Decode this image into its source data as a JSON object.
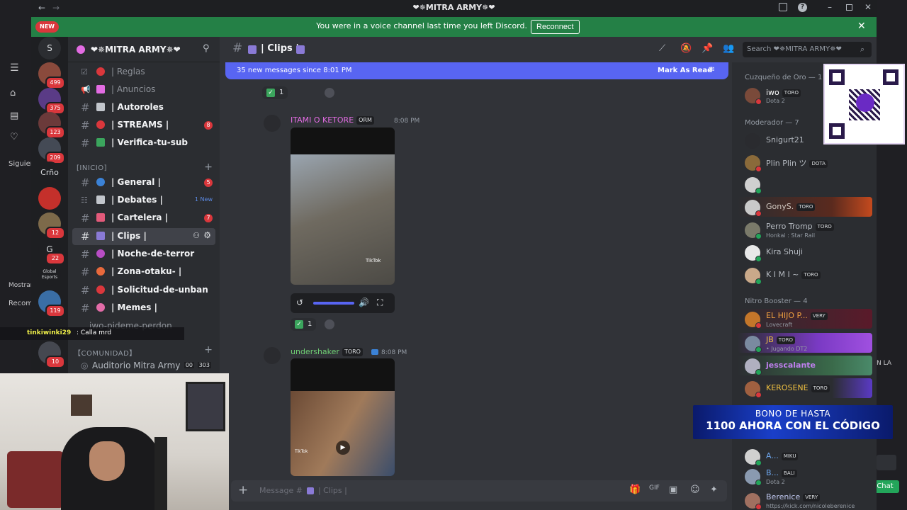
{
  "window": {
    "title": "❤✵MITRA ARMY✵❤"
  },
  "notice": {
    "text": "You were in a voice channel last time you left Discord.",
    "button": "Reconnect"
  },
  "guilds": [
    {
      "label": "NEW",
      "badge": ""
    },
    {
      "label": "S",
      "badge": ""
    },
    {
      "label": "",
      "badge": "499"
    },
    {
      "label": "",
      "badge": "375"
    },
    {
      "label": "",
      "badge": "123"
    },
    {
      "label": "",
      "badge": "209"
    },
    {
      "label": "Crño",
      "badge": ""
    },
    {
      "label": "",
      "badge": ""
    },
    {
      "label": "",
      "badge": "12"
    },
    {
      "label": "G",
      "badge": "22"
    },
    {
      "label": "Global Esports",
      "badge": ""
    },
    {
      "label": "",
      "badge": "119"
    },
    {
      "label": "",
      "badge": "10"
    }
  ],
  "server": {
    "name": "❤✵MITRA ARMY✵❤"
  },
  "channels": {
    "top": [
      {
        "name": "| Reglas",
        "badge": "",
        "muted": true
      },
      {
        "name": "| Anuncios",
        "badge": "",
        "muted": true
      },
      {
        "name": "| Autoroles",
        "badge": "",
        "muted": false
      },
      {
        "name": "| STREAMS |",
        "badge": "8",
        "muted": false
      },
      {
        "name": "| Verifica-tu-sub",
        "badge": "",
        "muted": false
      }
    ],
    "cat_inicio": "[INICIO]",
    "inicio": [
      {
        "name": "| General |",
        "badge": "5",
        "new": ""
      },
      {
        "name": "| Debates |",
        "badge": "",
        "new": "1 New"
      },
      {
        "name": "| Cartelera |",
        "badge": "7",
        "new": ""
      },
      {
        "name": "| Clips |",
        "badge": "",
        "new": ""
      },
      {
        "name": "| Noche-de-terror",
        "badge": "",
        "new": ""
      },
      {
        "name": "| Zona-otaku- |",
        "badge": "",
        "new": ""
      },
      {
        "name": "| Solicitud-de-unban",
        "badge": "",
        "new": ""
      },
      {
        "name": "| Memes |",
        "badge": "",
        "new": ""
      },
      {
        "name": "iwo-pideme-perdon",
        "badge": "",
        "new": ""
      }
    ],
    "cat_comunidad": "【COMUNIDAD】",
    "voice": {
      "name": "Auditorio Mitra Army",
      "count_a": "00",
      "count_b": "303"
    }
  },
  "chat": {
    "channel_title": "| Clips |",
    "search_placeholder": "Search ❤✵MITRA ARMY✵❤",
    "new_messages": "35 new messages since 8:01 PM",
    "mark_as_read": "Mark As Read",
    "reaction_count": "1",
    "messages": [
      {
        "author": "ITAMI O KETORE",
        "tag": "ORM",
        "time": "8:08 PM",
        "color": "#e36ce3"
      },
      {
        "author": "undershaker",
        "tag": "TORO",
        "time": "8:08 PM",
        "color": "#6fcf73"
      }
    ],
    "video_watermark": "TikTok",
    "input_placeholder": "Message #",
    "input_channel": "| Clips |"
  },
  "members": {
    "groups": [
      {
        "title": "Cuzqueño de Oro — 1",
        "items": [
          {
            "name": "iwo",
            "tag": "TORO",
            "sub": "Dota 2"
          }
        ]
      },
      {
        "title": "Moderador — 7",
        "items": [
          {
            "name": "Snigurt21",
            "tag": "",
            "sub": ""
          },
          {
            "name": "Plin Plin ツ",
            "tag": "DOTA",
            "sub": ""
          },
          {
            "name": "",
            "tag": "",
            "sub": ""
          },
          {
            "name": "GonyS.",
            "tag": "TORO",
            "sub": ""
          },
          {
            "name": "Perro Tromp",
            "tag": "TORO",
            "sub": "Honkai : Star Rail"
          },
          {
            "name": "Kira Shuji",
            "tag": "",
            "sub": ""
          },
          {
            "name": "K I M I ~",
            "tag": "TORO",
            "sub": ""
          }
        ]
      },
      {
        "title": "Nitro Booster — 4",
        "items": [
          {
            "name": "EL HIJO P...",
            "tag": "VERY",
            "sub": "Lovecraft"
          },
          {
            "name": "JB",
            "tag": "TORO",
            "sub": "• Jugando DT2"
          },
          {
            "name": "jesscalante",
            "tag": "",
            "sub": ""
          },
          {
            "name": "KEROSENE",
            "tag": "TORO",
            "sub": ""
          }
        ]
      },
      {
        "title": "",
        "items": [
          {
            "name": "A...",
            "tag": "MIKU",
            "sub": ""
          },
          {
            "name": "B...",
            "tag": "BALI",
            "sub": "Dota 2"
          },
          {
            "name": "Berenice",
            "tag": "VERY",
            "sub": "https://kick.com/nicoleberenice"
          }
        ]
      }
    ]
  },
  "overlay": {
    "promo_line1": "BONO DE HASTA",
    "promo_line2": "1100 AHORA CON EL CÓDIGO",
    "chat_button": "Chat",
    "stream_chat_user": "tinkiwinki29",
    "stream_chat_msg": ": Calla mrd",
    "side_left_labels": [
      "Siguien",
      "Recom",
      "Mostrar"
    ],
    "right_edge_text": "N LA"
  },
  "colors": {
    "accent": "#5865f2",
    "notice": "#248046",
    "danger": "#da373c"
  }
}
